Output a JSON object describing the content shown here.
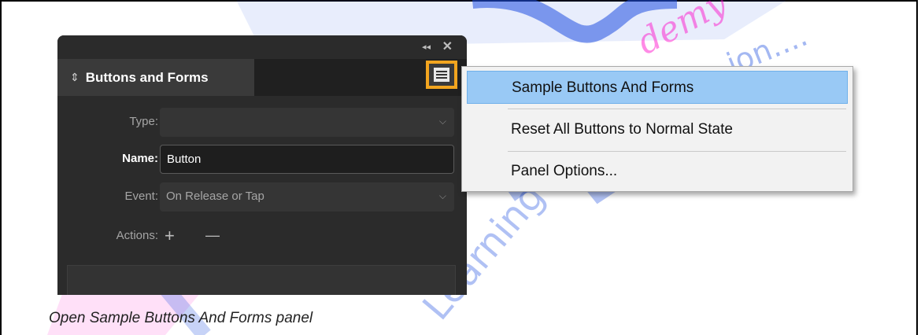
{
  "panel": {
    "collapse_glyph": "◂◂",
    "close_glyph": "✕",
    "tab_arrows": "⇕",
    "tab_title": "Buttons and Forms",
    "type_label": "Type:",
    "type_value": "",
    "name_label": "Name:",
    "name_value": "Button",
    "event_label": "Event:",
    "event_value": "On Release or Tap",
    "actions_label": "Actions:",
    "plus_glyph": "+",
    "minus_glyph": "—",
    "chevron_glyph": "⌵"
  },
  "menu": {
    "items": [
      {
        "label": "Sample Buttons And Forms",
        "highlighted": true
      },
      {
        "label": "Reset All Buttons to Normal State"
      },
      {
        "label": "Panel Options..."
      }
    ]
  },
  "caption": "Open Sample Buttons And Forms panel",
  "colors": {
    "panel_bg": "#2b2b2b",
    "highlight": "#f2a51f",
    "menu_selected": "#99c9f5",
    "watermark_blue": "#1f4fe0",
    "watermark_pink": "#ff00c8"
  }
}
